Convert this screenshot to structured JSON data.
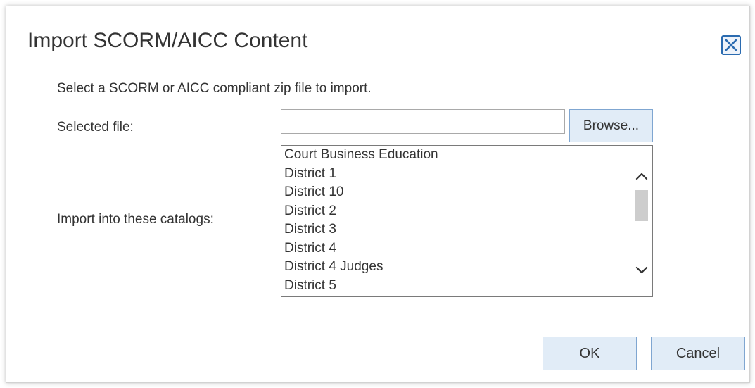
{
  "dialog": {
    "title": "Import SCORM/AICC Content",
    "instruction": "Select a SCORM or AICC compliant zip file to import.",
    "close_icon": "close-icon",
    "accent_color": "#2b6bb0"
  },
  "file": {
    "label": "Selected file:",
    "value": "",
    "browse_label": "Browse..."
  },
  "catalogs": {
    "label": "Import into these catalogs:",
    "items": [
      {
        "label": "Court Business Education"
      },
      {
        "label": "District 1"
      },
      {
        "label": "District 10"
      },
      {
        "label": "District 2"
      },
      {
        "label": "District 3"
      },
      {
        "label": "District 4"
      },
      {
        "label": "District 4 Judges"
      },
      {
        "label": "District 5"
      }
    ],
    "scroll_up_icon": "chevron-up-icon",
    "scroll_down_icon": "chevron-down-icon"
  },
  "actions": {
    "ok_label": "OK",
    "cancel_label": "Cancel"
  }
}
